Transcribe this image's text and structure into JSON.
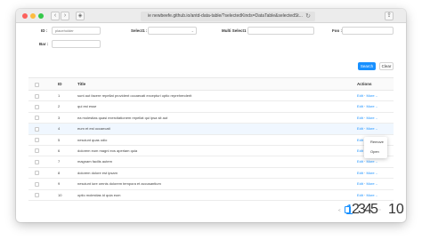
{
  "browser": {
    "address": "ie newbeefe.github.io/antd-data-table/?selectedKinds=DataTable&selectedSt..."
  },
  "filters": {
    "id_label": "ID :",
    "id_placeholder": "placeholder",
    "select1_label": "Select1 :",
    "multi_select1_label": "Multi Select1 :",
    "foo_label": "Foo :",
    "bar_label": "Bar :",
    "search_label": "Search",
    "clear_label": "Clear"
  },
  "table": {
    "headers": {
      "id": "ID",
      "title": "Title",
      "actions": "Actions"
    },
    "edit_label": "Edit",
    "more_label": "More",
    "rows": [
      {
        "id": "1",
        "title": "sunt aut facere repellat provident occaecati excepturi optio reprehenderit"
      },
      {
        "id": "2",
        "title": "qui est esse"
      },
      {
        "id": "3",
        "title": "ea molestias quasi exercitationem repellat qui ipsa sit aut"
      },
      {
        "id": "4",
        "title": "eum et est occaecati"
      },
      {
        "id": "5",
        "title": "nesciunt quas odio"
      },
      {
        "id": "6",
        "title": "dolorem eum magni eos aperiam quia"
      },
      {
        "id": "7",
        "title": "magnam facilis autem"
      },
      {
        "id": "8",
        "title": "dolorem dolore est ipsam"
      },
      {
        "id": "9",
        "title": "nesciunt iure omnis dolorem tempora et accusantium"
      },
      {
        "id": "10",
        "title": "optio molestias id quia eum"
      }
    ]
  },
  "dropdown": {
    "items": [
      "Remove",
      "Open"
    ]
  },
  "pagination": {
    "pages": [
      "1",
      "2",
      "3",
      "4",
      "5"
    ],
    "current": "1",
    "ellipsis": "•••",
    "last_page": "10",
    "prev": "<",
    "next": ">"
  },
  "colors": {
    "accent": "#1890ff",
    "hover_row": "#f0f7ff"
  }
}
